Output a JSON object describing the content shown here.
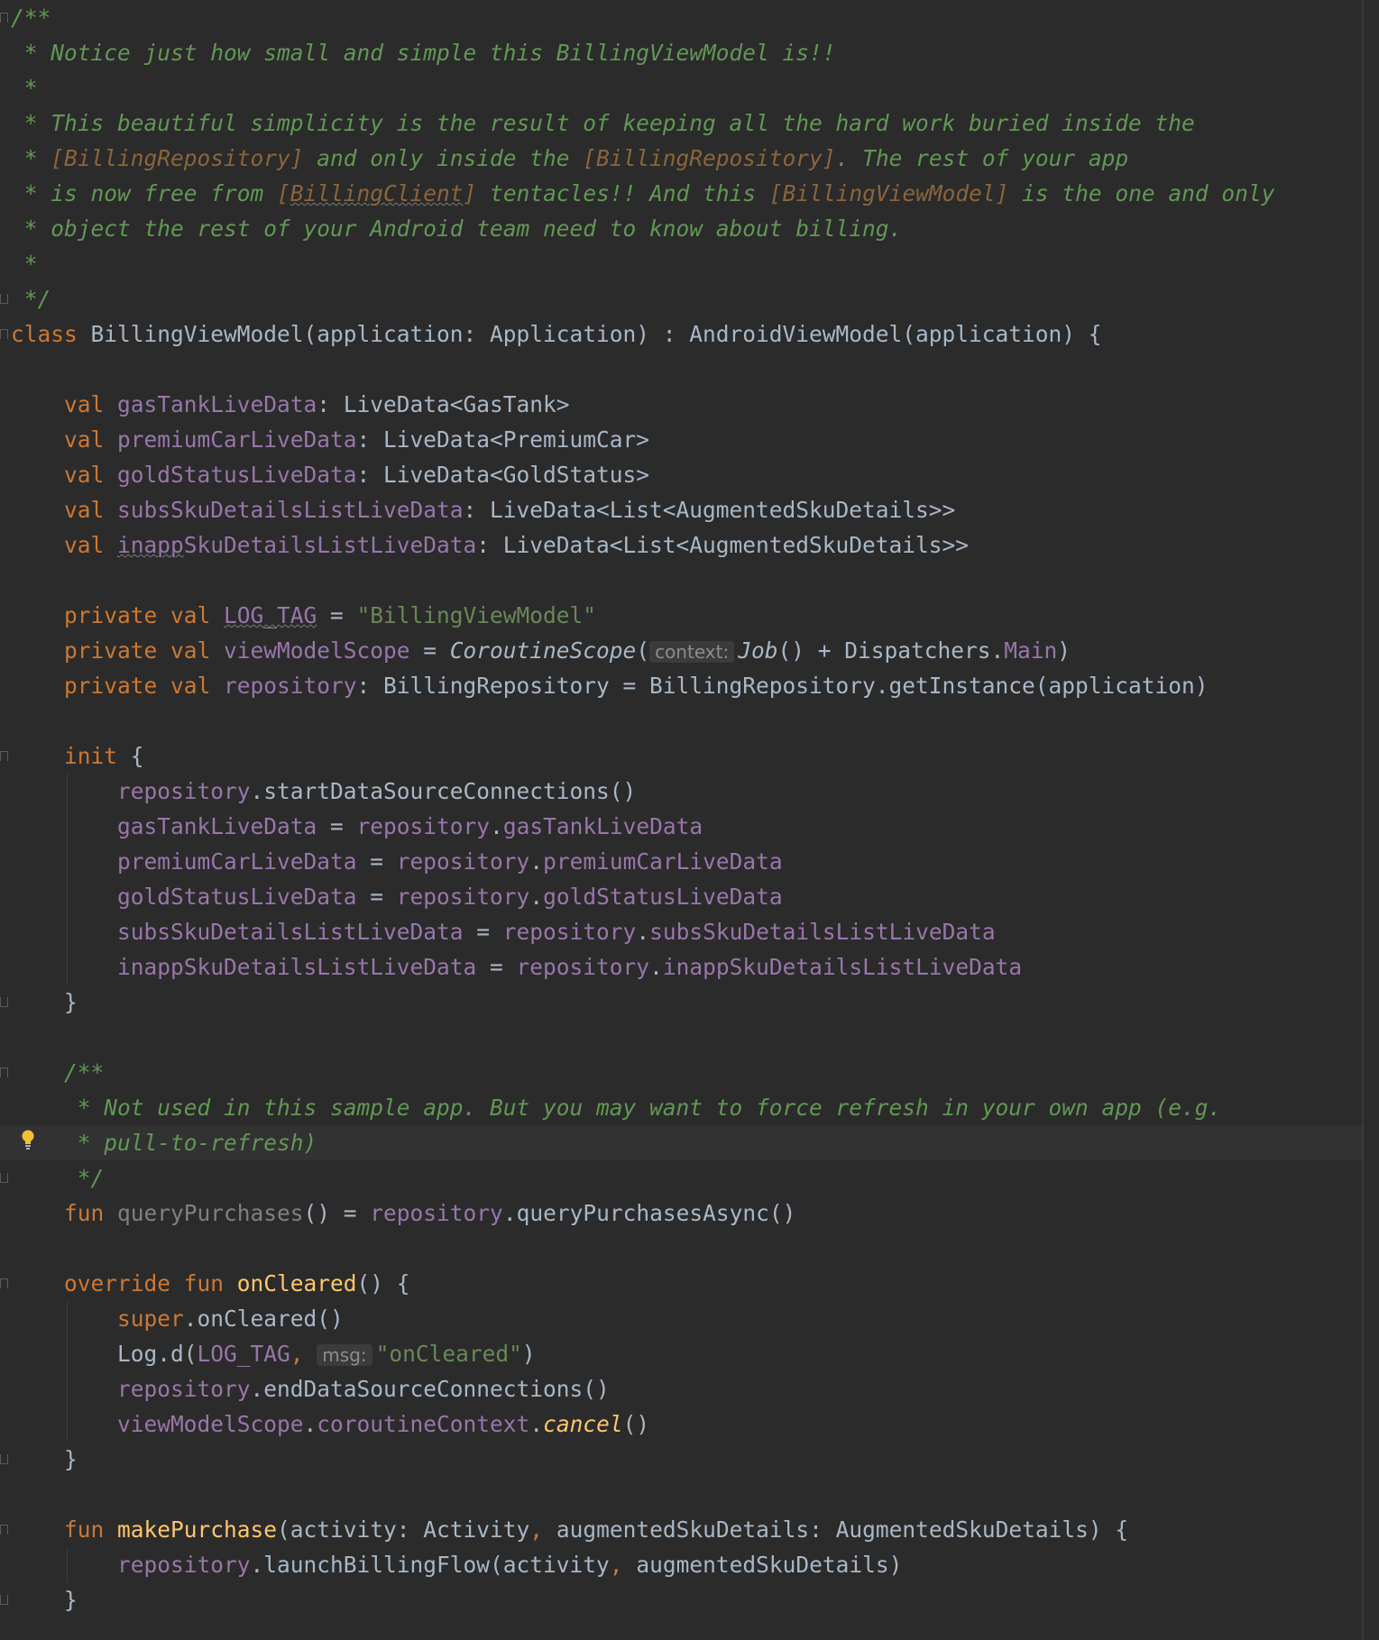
{
  "lines": [
    {
      "tokens": [
        {
          "t": "/**",
          "c": "c"
        }
      ]
    },
    {
      "tokens": [
        {
          "t": " * Notice just how small and simple this BillingViewModel is!!",
          "c": "c"
        }
      ]
    },
    {
      "tokens": [
        {
          "t": " *",
          "c": "c"
        }
      ]
    },
    {
      "tokens": [
        {
          "t": " * This beautiful simplicity is the result of keeping all the hard work buried inside the",
          "c": "c"
        }
      ]
    },
    {
      "tokens": [
        {
          "t": " * ",
          "c": "c"
        },
        {
          "t": "[BillingRepository]",
          "c": "c cr"
        },
        {
          "t": " and only inside the ",
          "c": "c"
        },
        {
          "t": "[BillingRepository]",
          "c": "c cr"
        },
        {
          "t": ". The rest of your app",
          "c": "c"
        }
      ]
    },
    {
      "tokens": [
        {
          "t": " * is now free from ",
          "c": "c"
        },
        {
          "t": "[",
          "c": "c cr"
        },
        {
          "t": "BillingClient",
          "c": "c cr u"
        },
        {
          "t": "]",
          "c": "c cr"
        },
        {
          "t": " tentacles!! And this ",
          "c": "c"
        },
        {
          "t": "[BillingViewModel]",
          "c": "c cr"
        },
        {
          "t": " is the one and only",
          "c": "c"
        }
      ]
    },
    {
      "tokens": [
        {
          "t": " * object the rest of your Android team need to know about billing.",
          "c": "c"
        }
      ]
    },
    {
      "tokens": [
        {
          "t": " *",
          "c": "c"
        }
      ]
    },
    {
      "tokens": [
        {
          "t": " */",
          "c": "c"
        }
      ]
    },
    {
      "tokens": [
        {
          "t": "class ",
          "c": "k"
        },
        {
          "t": "BillingViewModel(application: Application) : AndroidViewModel(application) {",
          "c": ""
        }
      ]
    },
    {
      "tokens": []
    },
    {
      "tokens": [
        {
          "t": "    val ",
          "c": "k"
        },
        {
          "t": "gasTankLiveData",
          "c": "f"
        },
        {
          "t": ": LiveData<GasTank>",
          "c": ""
        }
      ]
    },
    {
      "tokens": [
        {
          "t": "    val ",
          "c": "k"
        },
        {
          "t": "premiumCarLiveData",
          "c": "f"
        },
        {
          "t": ": LiveData<PremiumCar>",
          "c": ""
        }
      ]
    },
    {
      "tokens": [
        {
          "t": "    val ",
          "c": "k"
        },
        {
          "t": "goldStatusLiveData",
          "c": "f"
        },
        {
          "t": ": LiveData<GoldStatus>",
          "c": ""
        }
      ]
    },
    {
      "tokens": [
        {
          "t": "    val ",
          "c": "k"
        },
        {
          "t": "subsSkuDetailsListLiveData",
          "c": "f"
        },
        {
          "t": ": LiveData<List<AugmentedSkuDetails>>",
          "c": ""
        }
      ]
    },
    {
      "tokens": [
        {
          "t": "    val ",
          "c": "k"
        },
        {
          "t": "inapp",
          "c": "f u"
        },
        {
          "t": "SkuDetailsListLiveData",
          "c": "f"
        },
        {
          "t": ": LiveData<List<AugmentedSkuDetails>>",
          "c": ""
        }
      ]
    },
    {
      "tokens": []
    },
    {
      "tokens": [
        {
          "t": "    private val ",
          "c": "k"
        },
        {
          "t": "LOG_TAG",
          "c": "f u"
        },
        {
          "t": " = ",
          "c": ""
        },
        {
          "t": "\"BillingViewModel\"",
          "c": "s"
        }
      ]
    },
    {
      "tokens": [
        {
          "t": "    private val ",
          "c": "k"
        },
        {
          "t": "viewModelScope",
          "c": "f"
        },
        {
          "t": " = ",
          "c": ""
        },
        {
          "t": "CoroutineScope",
          "c": "it"
        },
        {
          "t": "(",
          "c": ""
        },
        {
          "t": "context:",
          "c": "hint"
        },
        {
          "t": "Job",
          "c": "it"
        },
        {
          "t": "() + Dispatchers.",
          "c": ""
        },
        {
          "t": "Main",
          "c": "f"
        },
        {
          "t": ")",
          "c": ""
        }
      ]
    },
    {
      "tokens": [
        {
          "t": "    private val ",
          "c": "k"
        },
        {
          "t": "repository",
          "c": "f"
        },
        {
          "t": ": BillingRepository = BillingRepository.getInstance(application)",
          "c": ""
        }
      ]
    },
    {
      "tokens": []
    },
    {
      "tokens": [
        {
          "t": "    init ",
          "c": "k"
        },
        {
          "t": "{",
          "c": ""
        }
      ]
    },
    {
      "tokens": [
        {
          "t": "        ",
          "c": ""
        },
        {
          "t": "repository",
          "c": "f"
        },
        {
          "t": ".startDataSourceConnections()",
          "c": ""
        }
      ]
    },
    {
      "tokens": [
        {
          "t": "        ",
          "c": ""
        },
        {
          "t": "gasTankLiveData",
          "c": "f"
        },
        {
          "t": " = ",
          "c": ""
        },
        {
          "t": "repository",
          "c": "f"
        },
        {
          "t": ".",
          "c": ""
        },
        {
          "t": "gasTankLiveData",
          "c": "f"
        }
      ]
    },
    {
      "tokens": [
        {
          "t": "        ",
          "c": ""
        },
        {
          "t": "premiumCarLiveData",
          "c": "f"
        },
        {
          "t": " = ",
          "c": ""
        },
        {
          "t": "repository",
          "c": "f"
        },
        {
          "t": ".",
          "c": ""
        },
        {
          "t": "premiumCarLiveData",
          "c": "f"
        }
      ]
    },
    {
      "tokens": [
        {
          "t": "        ",
          "c": ""
        },
        {
          "t": "goldStatusLiveData",
          "c": "f"
        },
        {
          "t": " = ",
          "c": ""
        },
        {
          "t": "repository",
          "c": "f"
        },
        {
          "t": ".",
          "c": ""
        },
        {
          "t": "goldStatusLiveData",
          "c": "f"
        }
      ]
    },
    {
      "tokens": [
        {
          "t": "        ",
          "c": ""
        },
        {
          "t": "subsSkuDetailsListLiveData",
          "c": "f"
        },
        {
          "t": " = ",
          "c": ""
        },
        {
          "t": "repository",
          "c": "f"
        },
        {
          "t": ".",
          "c": ""
        },
        {
          "t": "subsSkuDetailsListLiveData",
          "c": "f"
        }
      ]
    },
    {
      "tokens": [
        {
          "t": "        ",
          "c": ""
        },
        {
          "t": "inappSkuDetailsListLiveData",
          "c": "f"
        },
        {
          "t": " = ",
          "c": ""
        },
        {
          "t": "repository",
          "c": "f"
        },
        {
          "t": ".",
          "c": ""
        },
        {
          "t": "inappSkuDetailsListLiveData",
          "c": "f"
        }
      ]
    },
    {
      "tokens": [
        {
          "t": "    }",
          "c": ""
        }
      ]
    },
    {
      "tokens": []
    },
    {
      "tokens": [
        {
          "t": "    /**",
          "c": "c"
        }
      ]
    },
    {
      "tokens": [
        {
          "t": "     * Not used in this sample app. But you may want to force refresh in your own app (e.g.",
          "c": "c"
        }
      ]
    },
    {
      "tokens": [
        {
          "t": "     * pull-to-refresh)",
          "c": "c"
        }
      ]
    },
    {
      "tokens": [
        {
          "t": "     */",
          "c": "c"
        }
      ]
    },
    {
      "tokens": [
        {
          "t": "    fun ",
          "c": "k"
        },
        {
          "t": "queryPurchases",
          "c": "gr"
        },
        {
          "t": "() = ",
          "c": ""
        },
        {
          "t": "repository",
          "c": "f"
        },
        {
          "t": ".queryPurchasesAsync()",
          "c": ""
        }
      ]
    },
    {
      "tokens": []
    },
    {
      "tokens": [
        {
          "t": "    override fun ",
          "c": "k"
        },
        {
          "t": "onCleared",
          "c": "fn"
        },
        {
          "t": "() {",
          "c": ""
        }
      ]
    },
    {
      "tokens": [
        {
          "t": "        ",
          "c": ""
        },
        {
          "t": "super",
          "c": "k"
        },
        {
          "t": ".onCleared()",
          "c": ""
        }
      ]
    },
    {
      "tokens": [
        {
          "t": "        Log.d(",
          "c": ""
        },
        {
          "t": "LOG_TAG",
          "c": "f"
        },
        {
          "t": ", ",
          "c": "k"
        },
        {
          "t": "msg:",
          "c": "hint"
        },
        {
          "t": "\"onCleared\"",
          "c": "s"
        },
        {
          "t": ")",
          "c": ""
        }
      ]
    },
    {
      "tokens": [
        {
          "t": "        ",
          "c": ""
        },
        {
          "t": "repository",
          "c": "f"
        },
        {
          "t": ".endDataSourceConnections()",
          "c": ""
        }
      ]
    },
    {
      "tokens": [
        {
          "t": "        ",
          "c": ""
        },
        {
          "t": "viewModelScope",
          "c": "f"
        },
        {
          "t": ".",
          "c": ""
        },
        {
          "t": "coroutineContext",
          "c": "f"
        },
        {
          "t": ".",
          "c": ""
        },
        {
          "t": "cancel",
          "c": "fi"
        },
        {
          "t": "()",
          "c": ""
        }
      ]
    },
    {
      "tokens": [
        {
          "t": "    }",
          "c": ""
        }
      ]
    },
    {
      "tokens": []
    },
    {
      "tokens": [
        {
          "t": "    fun ",
          "c": "k"
        },
        {
          "t": "makePurchase",
          "c": "fn"
        },
        {
          "t": "(activity: Activity",
          "c": ""
        },
        {
          "t": ", ",
          "c": "k"
        },
        {
          "t": "augmentedSkuDetails: AugmentedSkuDetails) {",
          "c": ""
        }
      ]
    },
    {
      "tokens": [
        {
          "t": "        ",
          "c": ""
        },
        {
          "t": "repository",
          "c": "f"
        },
        {
          "t": ".launchBillingFlow(activity",
          "c": ""
        },
        {
          "t": ", ",
          "c": "k"
        },
        {
          "t": "augmentedSkuDetails)",
          "c": ""
        }
      ]
    },
    {
      "tokens": [
        {
          "t": "    }",
          "c": ""
        }
      ]
    }
  ],
  "current_line": 32,
  "intention_icon": "lightbulb-icon",
  "colors": {
    "background": "#2b2b2b",
    "current_line": "#323232",
    "comment": "#629755",
    "keyword": "#cc7832",
    "field": "#9876aa",
    "string": "#6a8759",
    "function": "#ffc66d",
    "text": "#a9b7c6"
  }
}
